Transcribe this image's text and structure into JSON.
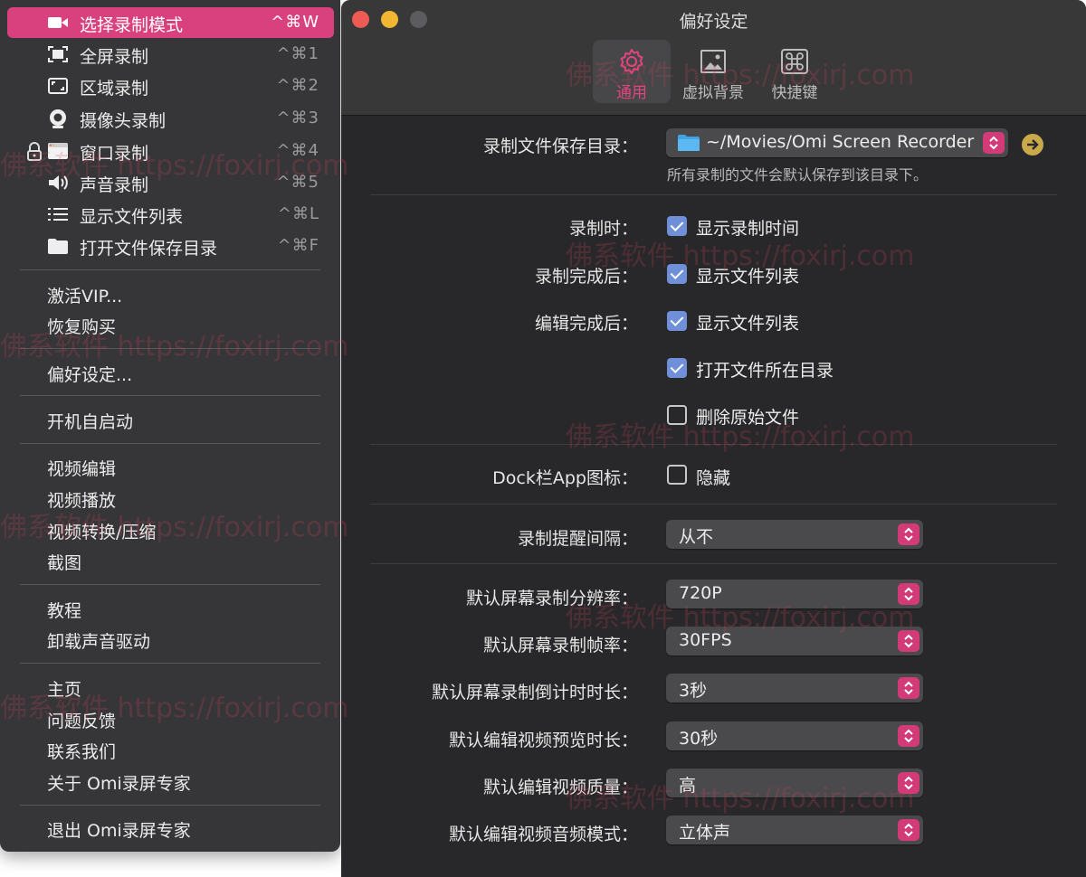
{
  "menu": {
    "items": [
      {
        "label": "选择录制模式",
        "shortcut": "^⌘W",
        "icon": "video-camera-icon"
      },
      {
        "label": "全屏录制",
        "shortcut": "^⌘1",
        "icon": "fullscreen-icon"
      },
      {
        "label": "区域录制",
        "shortcut": "^⌘2",
        "icon": "region-icon"
      },
      {
        "label": "摄像头录制",
        "shortcut": "^⌘3",
        "icon": "webcam-icon"
      },
      {
        "label": "窗口录制",
        "shortcut": "^⌘4",
        "icon": "window-icon"
      },
      {
        "label": "声音录制",
        "shortcut": "^⌘5",
        "icon": "speaker-icon"
      },
      {
        "label": "显示文件列表",
        "shortcut": "^⌘L",
        "icon": "list-icon"
      },
      {
        "label": "打开文件保存目录",
        "shortcut": "^⌘F",
        "icon": "folder-icon"
      }
    ],
    "vip": "激活VIP...",
    "restore": "恢复购买",
    "prefs": "偏好设定...",
    "autostart": "开机自启动",
    "edit": "视频编辑",
    "play": "视频播放",
    "convert": "视频转换/压缩",
    "screenshot": "截图",
    "tutorial": "教程",
    "uninstall": "卸载声音驱动",
    "home": "主页",
    "feedback": "问题反馈",
    "contact": "联系我们",
    "about": "关于 Omi录屏专家",
    "quit": "退出 Omi录屏专家"
  },
  "window": {
    "title": "偏好设定",
    "tabs": [
      "通用",
      "虚拟背景",
      "快捷键"
    ]
  },
  "general": {
    "save_dir_label": "录制文件保存目录：",
    "save_dir_value": "~/Movies/Omi Screen Recorder",
    "save_dir_hint": "所有录制的文件会默认保存到该目录下。",
    "recording_label": "录制时：",
    "recording_opt": "显示录制时间",
    "after_record_label": "录制完成后：",
    "after_record_opt": "显示文件列表",
    "after_edit_label": "编辑完成后：",
    "after_edit_opt1": "显示文件列表",
    "after_edit_opt2": "打开文件所在目录",
    "after_edit_opt3": "删除原始文件",
    "dock_label": "Dock栏App图标：",
    "dock_opt": "隐藏",
    "remind_label": "录制提醒间隔：",
    "remind_value": "从不",
    "res_label": "默认屏幕录制分辨率：",
    "res_value": "720P",
    "fps_label": "默认屏幕录制帧率：",
    "fps_value": "30FPS",
    "countdown_label": "默认屏幕录制倒计时时长：",
    "countdown_value": "3秒",
    "preview_label": "默认编辑视频预览时长：",
    "preview_value": "30秒",
    "quality_label": "默认编辑视频质量：",
    "quality_value": "高",
    "audio_label": "默认编辑视频音频模式：",
    "audio_value": "立体声"
  },
  "watermark": "佛系软件 https://foxirj.com",
  "colors": {
    "accent": "#d8407e",
    "checkbox": "#6f8fd8"
  }
}
